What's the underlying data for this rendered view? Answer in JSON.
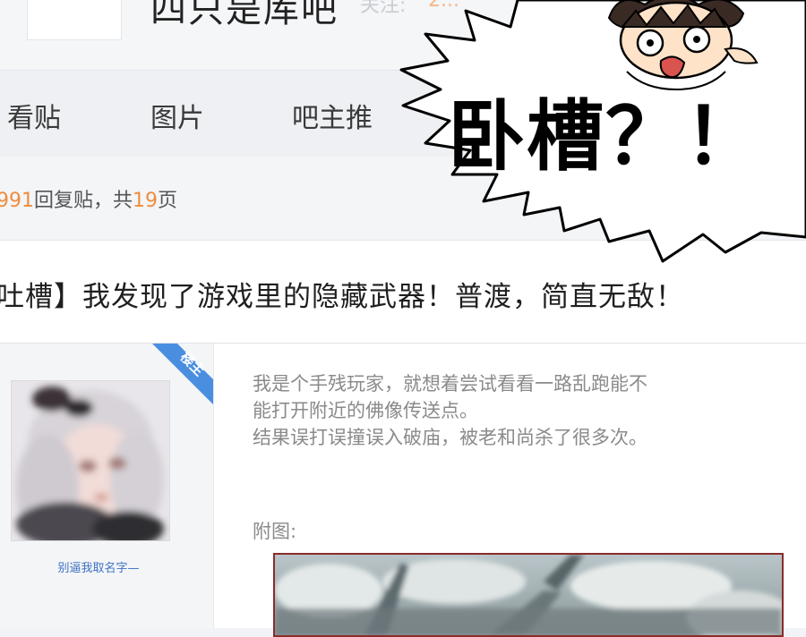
{
  "header": {
    "forum_title": "四只是库吧",
    "follow_label": "关注:",
    "follow_count": "2..."
  },
  "tabs": [
    {
      "label": "看贴"
    },
    {
      "label": "图片"
    },
    {
      "label": "吧主推"
    }
  ],
  "meta": {
    "reply_count": "991",
    "reply_label": "回复贴，共",
    "page_count": "19",
    "page_label": "页"
  },
  "post": {
    "title": "吐槽】我发现了游戏里的隐藏武器！普渡，简直无敌！",
    "op_badge": "楼主",
    "username": "别逼我取名字—",
    "body_lines": [
      "我是个手残玩家，就想着尝试看看一路乱跑能不",
      "能打开附近的佛像传送点。",
      "结果误打误撞误入破庙，被老和尚杀了很多次。"
    ],
    "attach_label": "附图:"
  },
  "comic": {
    "exclamation": "卧槽？！"
  },
  "colors": {
    "accent_orange": "#f08c3c",
    "link_blue": "#3d73c4",
    "badge_blue": "#4a8ee0"
  }
}
